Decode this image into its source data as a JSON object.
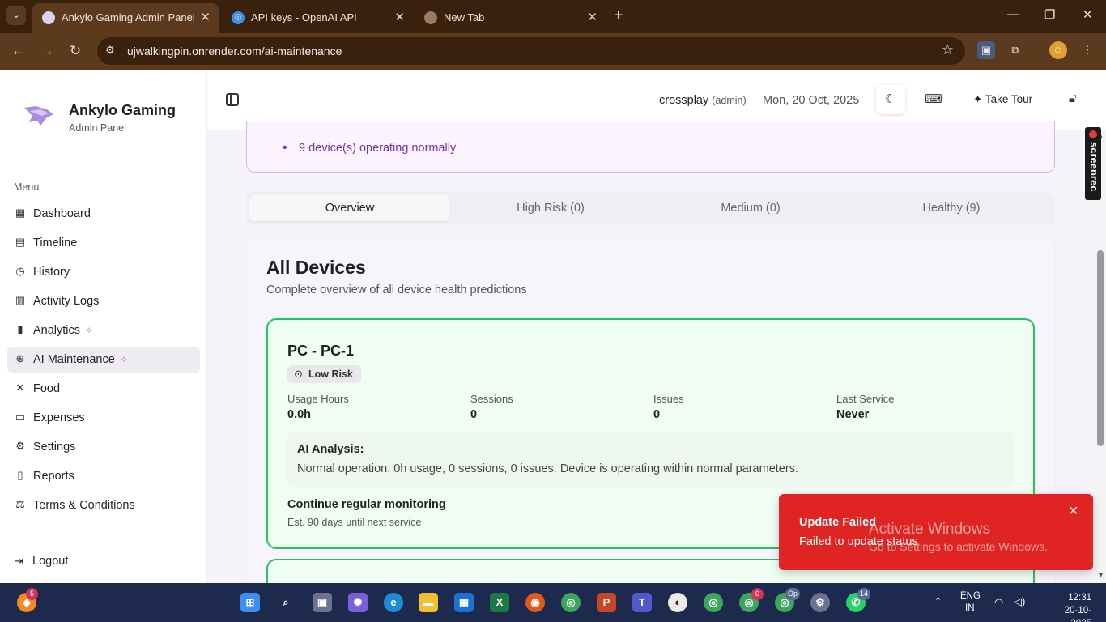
{
  "browser": {
    "tabs": [
      {
        "title": "Ankylo Gaming Admin Panel",
        "active": true
      },
      {
        "title": "API keys - OpenAI API",
        "active": false
      },
      {
        "title": "New Tab",
        "active": false
      }
    ],
    "url": "ujwalkingpin.onrender.com/ai-maintenance"
  },
  "sidebar": {
    "brand_title": "Ankylo Gaming",
    "brand_subtitle": "Admin Panel",
    "menu_label": "Menu",
    "items": [
      {
        "label": "Dashboard",
        "icon": "grid-icon"
      },
      {
        "label": "Timeline",
        "icon": "calendar-icon"
      },
      {
        "label": "History",
        "icon": "clock-icon"
      },
      {
        "label": "Activity Logs",
        "icon": "receipt-icon"
      },
      {
        "label": "Analytics",
        "icon": "bar-chart-icon"
      },
      {
        "label": "AI Maintenance",
        "icon": "brain-icon",
        "active": true
      },
      {
        "label": "Food",
        "icon": "utensils-icon"
      },
      {
        "label": "Expenses",
        "icon": "wallet-icon"
      },
      {
        "label": "Settings",
        "icon": "gear-icon"
      },
      {
        "label": "Reports",
        "icon": "file-icon"
      },
      {
        "label": "Terms & Conditions",
        "icon": "scale-icon"
      }
    ],
    "logout_label": "Logout"
  },
  "header": {
    "username": "crossplay",
    "role": "(admin)",
    "date": "Mon, 20 Oct, 2025",
    "tour_label": "Take Tour"
  },
  "alert": {
    "item": "9 device(s) operating normally"
  },
  "tabs": [
    {
      "label": "Overview",
      "active": true
    },
    {
      "label": "High Risk (0)"
    },
    {
      "label": "Medium (0)"
    },
    {
      "label": "Healthy (9)"
    }
  ],
  "panel": {
    "title": "All Devices",
    "subtitle": "Complete overview of all device health predictions"
  },
  "device": {
    "name": "PC - PC-1",
    "risk": "Low Risk",
    "stats": [
      {
        "label": "Usage Hours",
        "value": "0.0h"
      },
      {
        "label": "Sessions",
        "value": "0"
      },
      {
        "label": "Issues",
        "value": "0"
      },
      {
        "label": "Last Service",
        "value": "Never"
      }
    ],
    "ai_title": "AI Analysis:",
    "ai_text": "Normal operation: 0h usage, 0 sessions, 0 issues. Device is operating within normal parameters.",
    "recommendation": "Continue regular monitoring",
    "next_service": "Est. 90 days until next service"
  },
  "toast": {
    "title": "Update Failed",
    "message": "Failed to update status"
  },
  "watermark": {
    "title": "Activate Windows",
    "subtitle": "Go to Settings to activate Windows."
  },
  "screenrec_label": "screenrec",
  "taskbar": {
    "badges": {
      "brave": "5",
      "chrome_a": "0",
      "chrome_b": "Op",
      "whatsapp": "14"
    },
    "lang_line1": "ENG",
    "lang_line2": "IN",
    "time": "12:31",
    "date": "20-10-2025"
  },
  "colors": {
    "accent_purple": "#7a2ea8",
    "healthy_green": "#22c55e",
    "toast_red": "#e02424"
  }
}
